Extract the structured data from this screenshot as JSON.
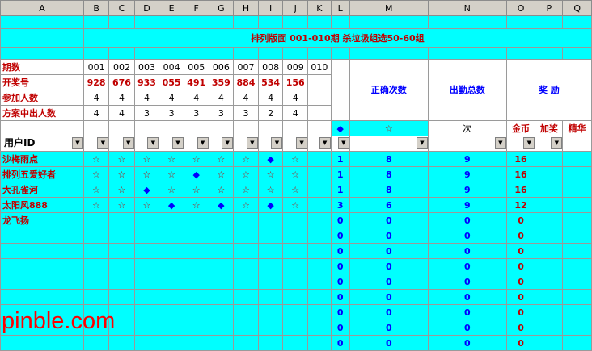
{
  "columns": [
    "A",
    "B",
    "C",
    "D",
    "E",
    "F",
    "G",
    "H",
    "I",
    "J",
    "K",
    "L",
    "M",
    "N",
    "O",
    "P",
    "Q"
  ],
  "title": "排列版面  001-010期  杀垃圾组选50-60组",
  "issue_label": "期数",
  "issues": [
    "001",
    "002",
    "003",
    "004",
    "005",
    "006",
    "007",
    "008",
    "009",
    "010"
  ],
  "draw_label": "开奖号",
  "draws": [
    "928",
    "676",
    "933",
    "055",
    "491",
    "359",
    "884",
    "534",
    "156",
    ""
  ],
  "participants_label": "参加人数",
  "participants": [
    "4",
    "4",
    "4",
    "4",
    "4",
    "4",
    "4",
    "4",
    "4",
    ""
  ],
  "hits_label": "方案中出人数",
  "hits": [
    "4",
    "4",
    "3",
    "3",
    "3",
    "3",
    "3",
    "2",
    "4",
    ""
  ],
  "col_correct": "正确次数",
  "col_attendance": "出勤总数",
  "col_reward": "奖  励",
  "legend_diamond": "◆",
  "legend_star": "☆",
  "legend_times": "次",
  "reward_coins": "金币",
  "reward_bonus": "加奖",
  "reward_elite": "精华",
  "user_id_label": "用户ID",
  "users": [
    {
      "name": "沙梅雨点",
      "marks": [
        "☆",
        "☆",
        "☆",
        "☆",
        "☆",
        "☆",
        "☆",
        "◆",
        "☆",
        ""
      ],
      "diamond": "1",
      "correct": "8",
      "attend": "9",
      "coins": "16"
    },
    {
      "name": "排列五爱好者",
      "marks": [
        "☆",
        "☆",
        "☆",
        "☆",
        "◆",
        "☆",
        "☆",
        "☆",
        "☆",
        ""
      ],
      "diamond": "1",
      "correct": "8",
      "attend": "9",
      "coins": "16"
    },
    {
      "name": "大孔雀河",
      "marks": [
        "☆",
        "☆",
        "◆",
        "☆",
        "☆",
        "☆",
        "☆",
        "☆",
        "☆",
        ""
      ],
      "diamond": "1",
      "correct": "8",
      "attend": "9",
      "coins": "16"
    },
    {
      "name": "太阳风888",
      "marks": [
        "☆",
        "☆",
        "☆",
        "◆",
        "☆",
        "◆",
        "☆",
        "◆",
        "☆",
        ""
      ],
      "diamond": "3",
      "correct": "6",
      "attend": "9",
      "coins": "12"
    },
    {
      "name": "龙飞扬",
      "marks": [
        "",
        "",
        "",
        "",
        "",
        "",
        "",
        "",
        "",
        ""
      ],
      "diamond": "0",
      "correct": "0",
      "attend": "0",
      "coins": "0"
    },
    {
      "name": "",
      "marks": [
        "",
        "",
        "",
        "",
        "",
        "",
        "",
        "",
        "",
        ""
      ],
      "diamond": "0",
      "correct": "0",
      "attend": "0",
      "coins": "0"
    },
    {
      "name": "",
      "marks": [
        "",
        "",
        "",
        "",
        "",
        "",
        "",
        "",
        "",
        ""
      ],
      "diamond": "0",
      "correct": "0",
      "attend": "0",
      "coins": "0"
    },
    {
      "name": "",
      "marks": [
        "",
        "",
        "",
        "",
        "",
        "",
        "",
        "",
        "",
        ""
      ],
      "diamond": "0",
      "correct": "0",
      "attend": "0",
      "coins": "0"
    },
    {
      "name": "",
      "marks": [
        "",
        "",
        "",
        "",
        "",
        "",
        "",
        "",
        "",
        ""
      ],
      "diamond": "0",
      "correct": "0",
      "attend": "0",
      "coins": "0"
    },
    {
      "name": "",
      "marks": [
        "",
        "",
        "",
        "",
        "",
        "",
        "",
        "",
        "",
        ""
      ],
      "diamond": "0",
      "correct": "0",
      "attend": "0",
      "coins": "0"
    },
    {
      "name": "",
      "marks": [
        "",
        "",
        "",
        "",
        "",
        "",
        "",
        "",
        "",
        ""
      ],
      "diamond": "0",
      "correct": "0",
      "attend": "0",
      "coins": "0"
    },
    {
      "name": "",
      "marks": [
        "",
        "",
        "",
        "",
        "",
        "",
        "",
        "",
        "",
        ""
      ],
      "diamond": "0",
      "correct": "0",
      "attend": "0",
      "coins": "0"
    },
    {
      "name": "",
      "marks": [
        "",
        "",
        "",
        "",
        "",
        "",
        "",
        "",
        "",
        ""
      ],
      "diamond": "0",
      "correct": "0",
      "attend": "0",
      "coins": "0"
    }
  ],
  "watermark": "pinble.com",
  "colors": {
    "cyan": "#00ffff",
    "red": "#c00000",
    "blue": "#0000ff",
    "header_gray": "#d4d0c8"
  }
}
